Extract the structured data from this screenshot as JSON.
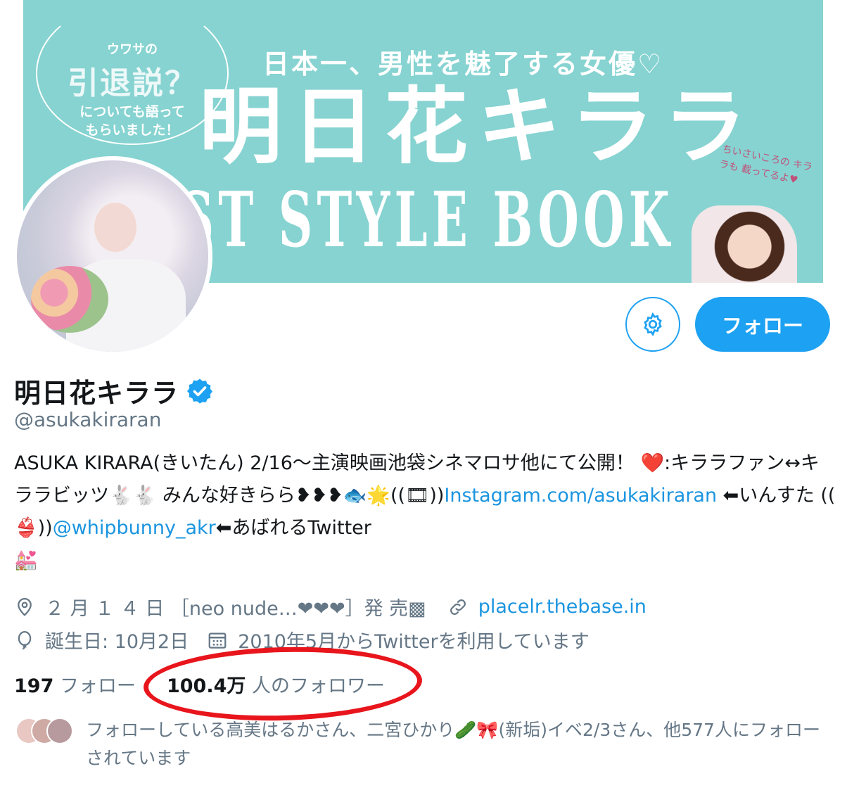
{
  "banner": {
    "badge_line1": "ウワサの",
    "badge_line2": "引退説？",
    "badge_line3": "についても語って\nもらいました！",
    "tagline": "日本一、男性を魅了する女優♡",
    "title": "明日花キララ",
    "subtitle": "1ST STYLE BOOK",
    "note": "ちいさいころの キララも 載ってるよ♥",
    "accent_color": "#86d3d1"
  },
  "avatar": {
    "description_icon": "profile-photo"
  },
  "actions": {
    "settings_icon": "gear-icon",
    "follow_label": "フォロー",
    "brand_color": "#1da1f2"
  },
  "profile": {
    "name": "明日花キララ",
    "handle": "@asukakiraran",
    "bio": {
      "part1": "ASUKA KIRARA(きいたん) 2/16〜主演映画池袋シネマロサ他にて公開！ ",
      "heart": "❤️",
      "part2": ":キララファン↔キララビッツ",
      "rabbits": "🐇🐇",
      "part3": " みんな好きらら",
      "hearts2": "❥❥❥",
      "fish": "🐟",
      "star": "🌟",
      "part4": "((",
      "film": "🎞",
      "part5": "))",
      "instagram": "Instagram.com/asukakiraran",
      "part6": " ⬅いんすた ((",
      "bikini": "👙",
      "part7": "))",
      "twitter_link": "@whipbunny_akr",
      "part8": "⬅あばれるTwitter",
      "wedding": "💒"
    },
    "location": "２ 月 １ ４ 日 ［neo nude…❤︎❤︎❤︎］発 売▩",
    "website": "placelr.thebase.in",
    "birthday": "誕生日: 10月2日",
    "joined": "2010年5月からTwitterを利用しています",
    "following_count": "197",
    "following_label": "フォロー",
    "followers_count": "100.4万",
    "followers_label": "人のフォロワー",
    "mutual_text": "フォローしている高美はるかさん、二宮ひかり🥒🎀(新垢)イベ2/3さん、他577人にフォローされています"
  },
  "annotation": {
    "highlight_color": "#e8151c"
  }
}
